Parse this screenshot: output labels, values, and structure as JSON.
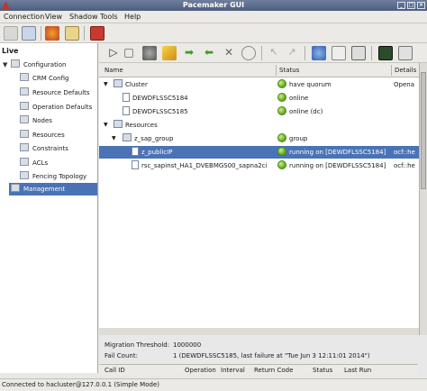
{
  "window": {
    "title": "Pacemaker GUI"
  },
  "menu": [
    {
      "label": "Connection"
    },
    {
      "label": "View"
    },
    {
      "label": "Shadow"
    },
    {
      "label": "Tools"
    },
    {
      "label": "Help"
    }
  ],
  "toolbar_icons": [
    "connect-icon",
    "disconnect-icon",
    "cluster-icon",
    "edit-icon",
    "exit-icon"
  ],
  "sidebar": {
    "heading": "Live",
    "items": [
      {
        "label": "Configuration",
        "icon": "configuration-icon"
      },
      {
        "label": "CRM Config",
        "icon": "crm-config-icon"
      },
      {
        "label": "Resource Defaults",
        "icon": "resource-defaults-icon"
      },
      {
        "label": "Operation Defaults",
        "icon": "operation-defaults-icon"
      },
      {
        "label": "Nodes",
        "icon": "nodes-icon"
      },
      {
        "label": "Resources",
        "icon": "resources-icon"
      },
      {
        "label": "Constraints",
        "icon": "constraints-icon"
      },
      {
        "label": "ACLs",
        "icon": "acls-icon"
      },
      {
        "label": "Fencing Topology",
        "icon": "fencing-topology-icon"
      },
      {
        "label": "Management",
        "icon": "management-icon"
      }
    ]
  },
  "management_toolbar_icons": [
    "start-icon",
    "stop-icon",
    "migrate-icon",
    "cleanup-icon",
    "move-icon",
    "unmove-icon",
    "delete-icon",
    "default-icon",
    "maintenance-icon",
    "standby-icon",
    "refresh-icon",
    "view-icon",
    "edit-icon",
    "view-details-icon",
    "xml-icon"
  ],
  "tree": {
    "columns": {
      "name": "Name",
      "status": "Status",
      "details": "Details"
    },
    "rows": [
      {
        "name": "Cluster",
        "status": "have quorum",
        "details": "Opena"
      },
      {
        "name": "DEWDFLSSC5184",
        "status": "online",
        "details": ""
      },
      {
        "name": "DEWDFLSSC5185",
        "status": "online (dc)",
        "details": ""
      },
      {
        "name": "Resources",
        "status": "",
        "details": ""
      },
      {
        "name": "z_sap_group",
        "status": "group",
        "details": ""
      },
      {
        "name": "z_publicIP",
        "status": "running on [DEWDFLSSC5184]",
        "details": "ocf::he"
      },
      {
        "name": "rsc_sapinst_HA1_DVEBMGS00_sapna2ci",
        "status": "running on [DEWDFLSSC5184]",
        "details": "ocf::he"
      }
    ]
  },
  "details": {
    "migration_threshold_label": "Migration Threshold:",
    "migration_threshold_value": "1000000",
    "fail_count_label": "Fail Count:",
    "fail_count_value": "1  (DEWDFLSSC5185,  last failure at \"Tue Jun  3 12:11:01 2014\")"
  },
  "operations": {
    "columns": [
      "Call ID",
      "Operation",
      "Interval",
      "Return Code",
      "Status",
      "Last Run"
    ]
  },
  "statusbar": {
    "text": "Connected to hacluster@127.0.0.1 (Simple Mode)"
  },
  "colors": {
    "selection": "#4a73b5",
    "running": "#5ea514"
  }
}
